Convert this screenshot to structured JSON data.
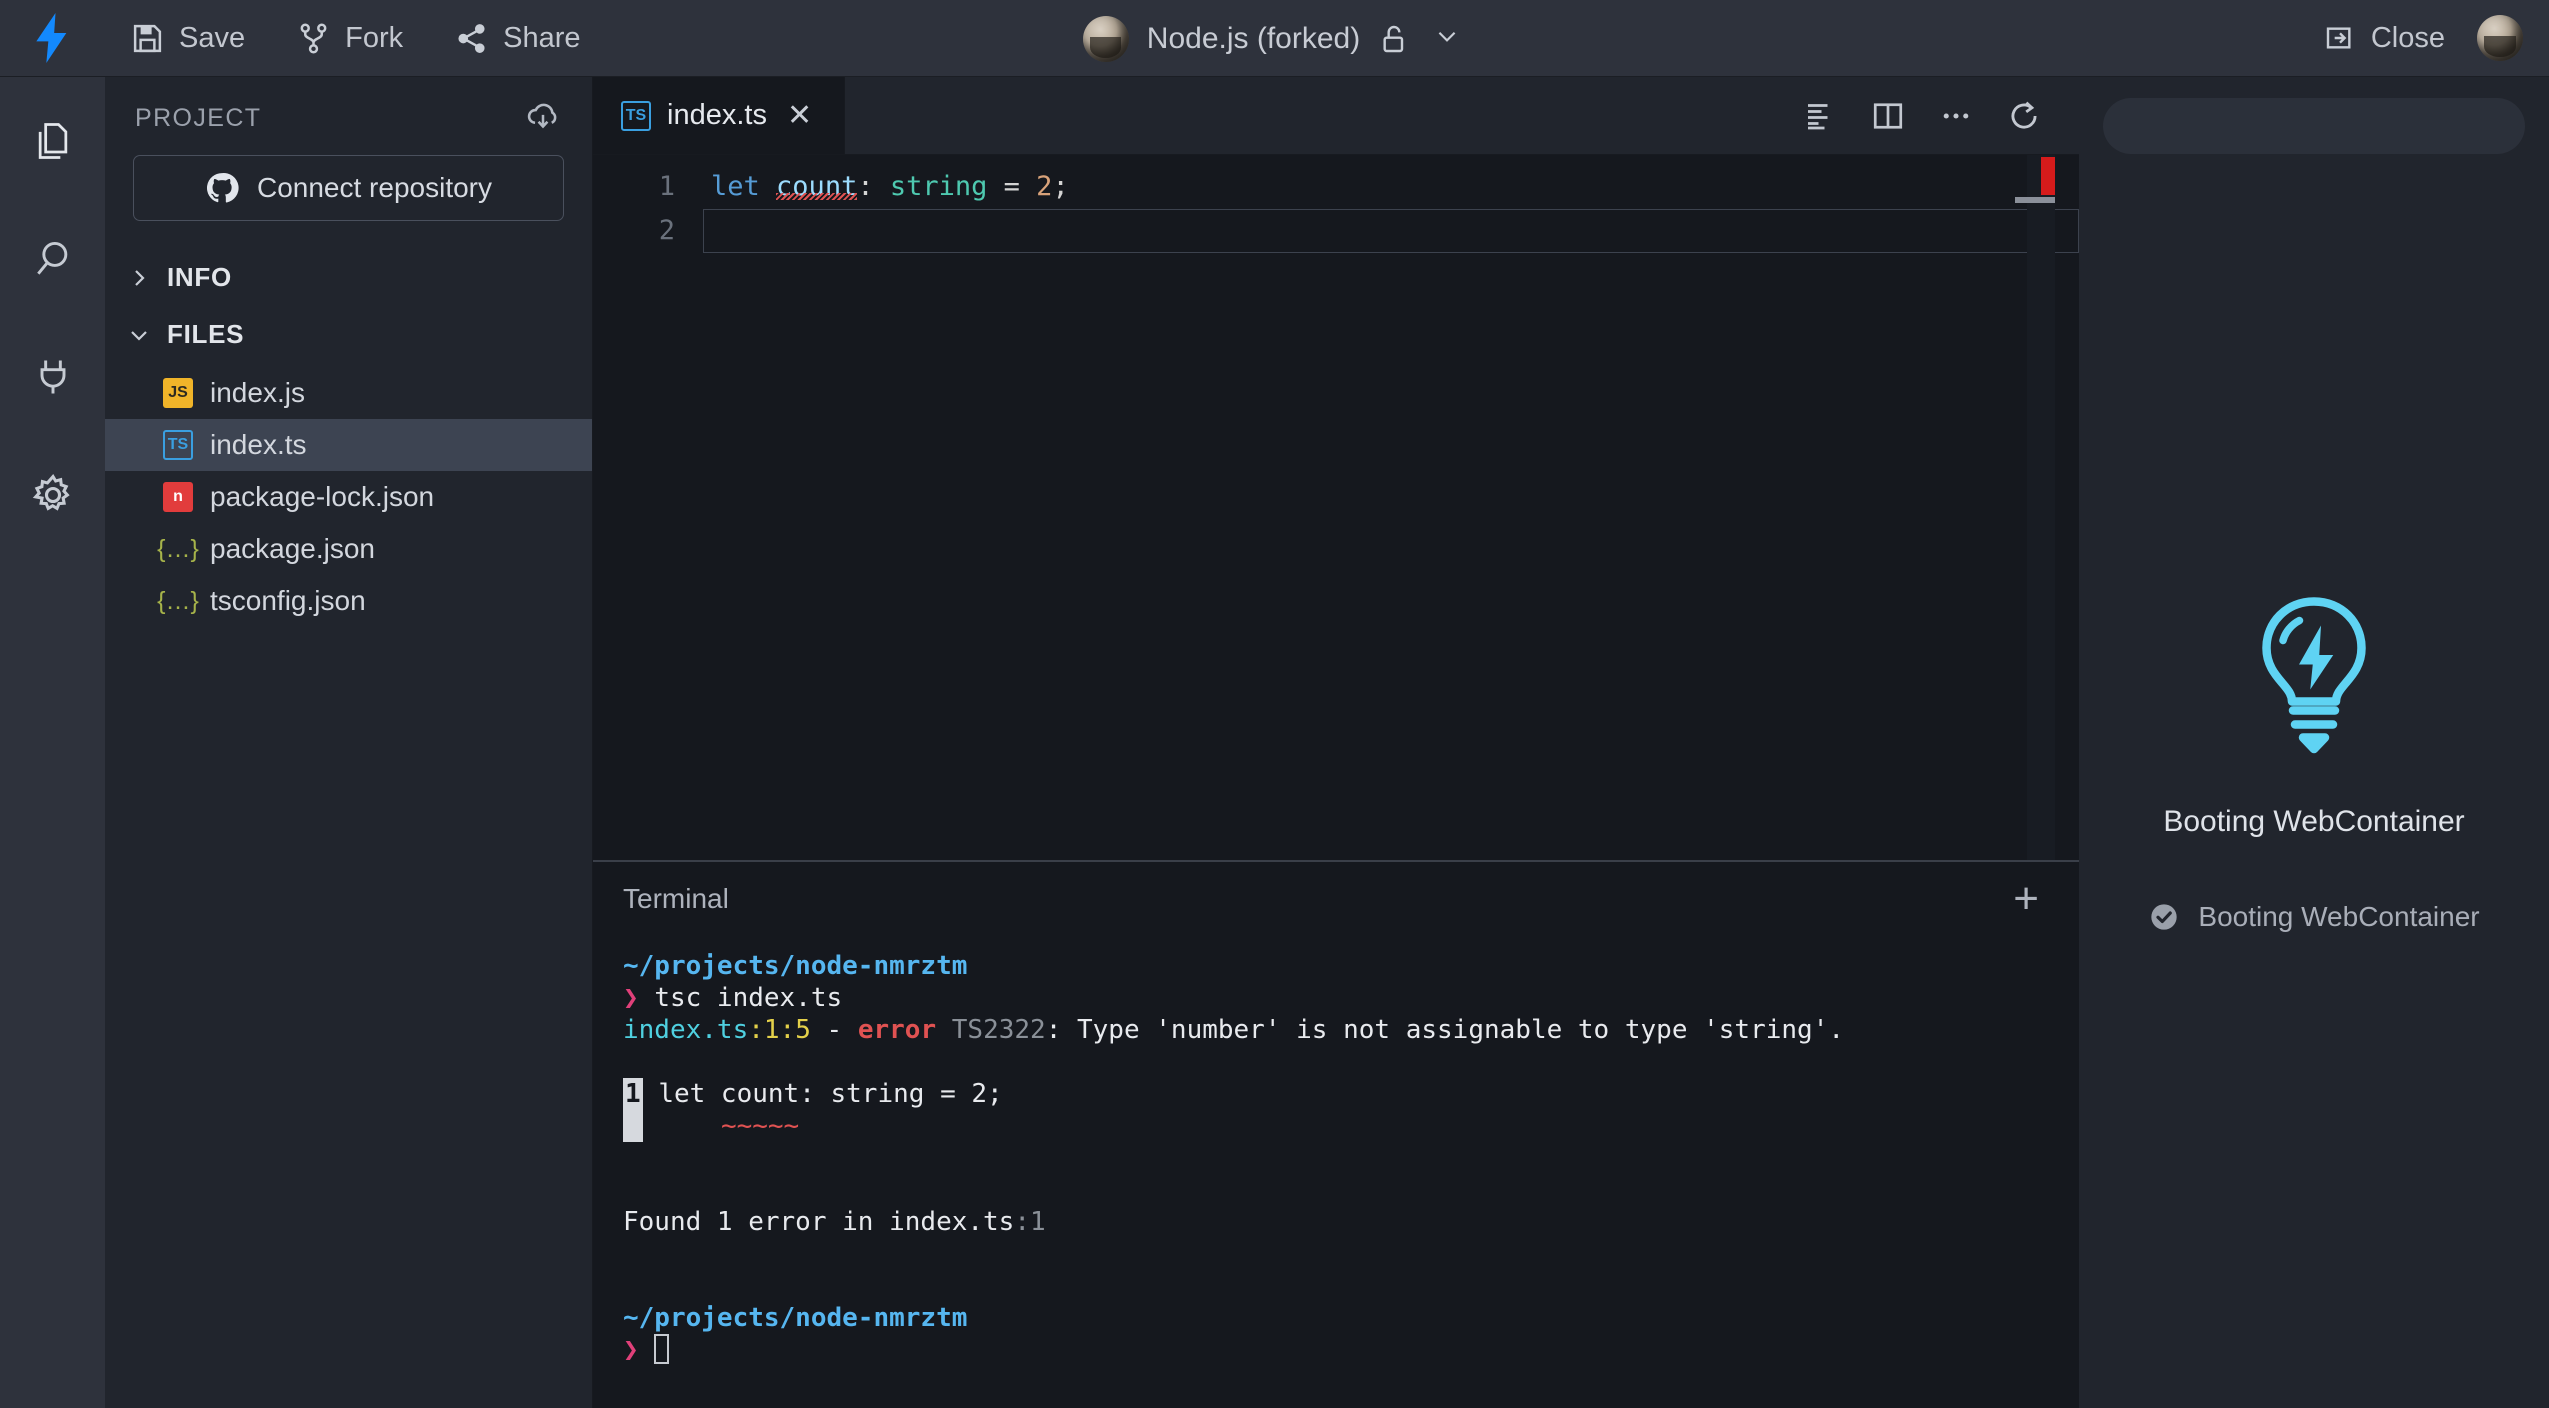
{
  "header": {
    "logo_icon": "stackblitz-lightning-icon",
    "buttons": [
      {
        "label": "Save",
        "icon": "save-floppy-icon"
      },
      {
        "label": "Fork",
        "icon": "fork-branch-icon"
      },
      {
        "label": "Share",
        "icon": "share-nodes-icon"
      }
    ],
    "project_title": "Node.js (forked)",
    "lock_icon": "unlocked-padlock-icon",
    "chevron_icon": "chevron-down-icon",
    "close_label": "Close",
    "close_icon": "sign-out-icon",
    "avatar_icon": "user-avatar"
  },
  "activity_bar": {
    "items": [
      {
        "name": "files",
        "icon": "files-copy-icon"
      },
      {
        "name": "search",
        "icon": "search-magnifier-icon"
      },
      {
        "name": "connect",
        "icon": "plug-icon"
      },
      {
        "name": "settings",
        "icon": "gear-icon"
      }
    ]
  },
  "sidebar": {
    "title": "PROJECT",
    "download_icon": "cloud-download-icon",
    "connect_repository_label": "Connect repository",
    "github_icon": "github-octocat-icon",
    "sections": [
      {
        "label": "INFO",
        "expanded": false,
        "chevron": "chevron-right-icon"
      },
      {
        "label": "FILES",
        "expanded": true,
        "chevron": "chevron-down-icon"
      }
    ],
    "files": [
      {
        "name": "index.js",
        "icon": "js-file-icon",
        "icon_text": "JS",
        "kind": "js",
        "selected": false
      },
      {
        "name": "index.ts",
        "icon": "ts-file-icon",
        "icon_text": "TS",
        "kind": "ts",
        "selected": true
      },
      {
        "name": "package-lock.json",
        "icon": "npm-file-icon",
        "icon_text": "n",
        "kind": "npm",
        "selected": false
      },
      {
        "name": "package.json",
        "icon": "json-file-icon",
        "icon_text": "{…}",
        "kind": "json",
        "selected": false
      },
      {
        "name": "tsconfig.json",
        "icon": "json-file-icon",
        "icon_text": "{…}",
        "kind": "json",
        "selected": false
      }
    ]
  },
  "editor": {
    "tab": {
      "label": "index.ts",
      "icon_text": "TS",
      "close_icon": "close-x-icon"
    },
    "tools": [
      {
        "name": "format-code",
        "icon": "format-lines-icon"
      },
      {
        "name": "split-editor",
        "icon": "split-panel-icon"
      },
      {
        "name": "more-options",
        "icon": "ellipsis-icon"
      },
      {
        "name": "reload-editor",
        "icon": "reload-circular-arrow-icon"
      }
    ],
    "lines": [
      "1",
      "2"
    ],
    "code": {
      "keyword": "let",
      "variable": "count",
      "colon": ": ",
      "type": "string",
      "assign": " = ",
      "value": "2",
      "semicolon": ";"
    },
    "full_line": "let count: string = 2;"
  },
  "terminal": {
    "title": "Terminal",
    "add_icon": "plus-icon",
    "path": "~/projects/node-nmrztm",
    "prompt": "❯",
    "command": "tsc index.ts",
    "error": {
      "file": "index.ts",
      "position": ":1:5",
      "dash": " - ",
      "severity": "error",
      "code": "TS2322",
      "message": ": Type 'number' is not assignable to type 'string'."
    },
    "excerpt": {
      "line_number": "1",
      "code": "let count: string = 2;",
      "squiggle": "~~~~~"
    },
    "summary_prefix": "Found 1 error in index.ts",
    "summary_suffix": ":1",
    "path_2": "~/projects/node-nmrztm",
    "prompt_2": "❯"
  },
  "preview": {
    "logo_icon": "lightbulb-lightning-icon",
    "title": "Booting WebContainer",
    "status_icon": "check-circle-icon",
    "status_text": "Booting WebContainer",
    "accent_color": "#5fd3f3"
  }
}
